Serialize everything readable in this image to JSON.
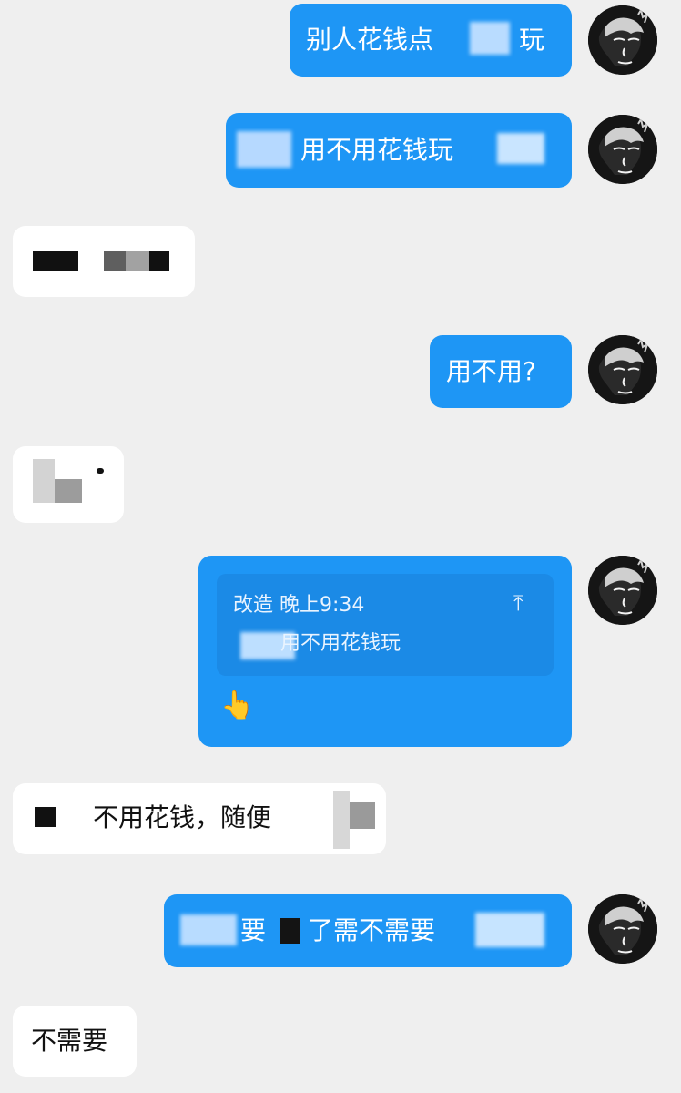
{
  "messages": [
    {
      "id": "m1",
      "side": "out",
      "text_left": "别人花钱点",
      "text_right": "玩"
    },
    {
      "id": "m2",
      "side": "out",
      "text": "用不用花钱玩"
    },
    {
      "id": "m3",
      "side": "in"
    },
    {
      "id": "m4",
      "side": "out",
      "text": "用不用?"
    },
    {
      "id": "m5",
      "side": "in"
    },
    {
      "id": "m6",
      "side": "out",
      "quote": {
        "meta": "改造 晚上9:34",
        "text": "用不用花钱玩",
        "arrow": "⤒"
      },
      "emoji": "👆"
    },
    {
      "id": "m7",
      "side": "in",
      "text": "不用花钱，随便"
    },
    {
      "id": "m8",
      "side": "out",
      "text_a": "要",
      "text_b": "了需不需要"
    },
    {
      "id": "m9",
      "side": "in",
      "text": "不需要"
    }
  ],
  "colors": {
    "background": "#efefef",
    "bubble_out": "#1e96f5",
    "bubble_in": "#ffffff",
    "quote_card": "#1b8ae6"
  },
  "icons": {
    "avatar": "avatar-icon",
    "quote_arrow": "jump-to-message-icon",
    "emoji": "pointing-up-emoji"
  }
}
